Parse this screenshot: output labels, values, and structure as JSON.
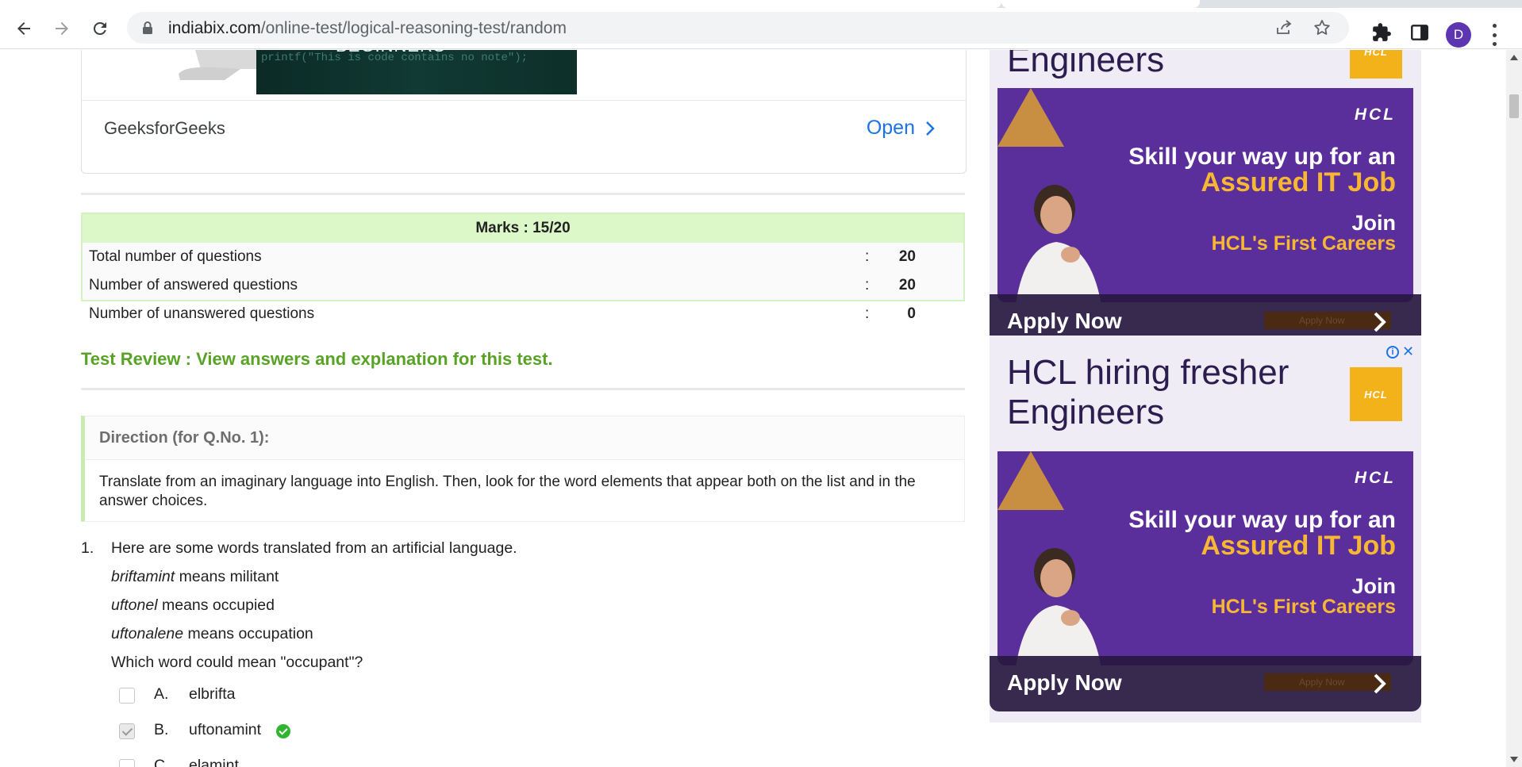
{
  "browser": {
    "url_host": "indiabix.com",
    "url_path": "/online-test/logical-reasoning-test/random",
    "profile_initial": "D"
  },
  "top_ad": {
    "thumbnail_heading": "BEGINNERS",
    "thumbnail_code": "printf(\"This is code contains no note\");",
    "brand": "GeeksforGeeks",
    "open_label": "Open"
  },
  "marks": {
    "heading": "Marks : 15/20",
    "rows": [
      {
        "label": "Total number of questions",
        "colon": ":",
        "value": "20"
      },
      {
        "label": "Number of answered questions",
        "colon": ":",
        "value": "20"
      },
      {
        "label": "Number of unanswered questions",
        "colon": ":",
        "value": "0"
      }
    ]
  },
  "review_link": "Test Review : View answers and explanation for this test.",
  "direction": {
    "heading": "Direction (for Q.No. 1):",
    "text": "Translate from an imaginary language into English. Then, look for the word elements that appear both on the list and in the answer choices."
  },
  "question": {
    "number": "1.",
    "intro": "Here are some words translated from an artificial language.",
    "definitions": [
      {
        "word": "briftamint",
        "meaning": " means militant"
      },
      {
        "word": "uftonel",
        "meaning": " means occupied"
      },
      {
        "word": "uftonalene",
        "meaning": " means occupation"
      }
    ],
    "prompt": "Which word could mean \"occupant\"?",
    "options": [
      {
        "letter": "A.",
        "text": "elbrifta",
        "checked": false,
        "correct": false
      },
      {
        "letter": "B.",
        "text": "uftonamint",
        "checked": true,
        "correct": true
      },
      {
        "letter": "C.",
        "text": "elamint",
        "checked": false,
        "correct": false
      }
    ]
  },
  "right_ads": [
    {
      "title_line1": "",
      "title_line2": "Engineers",
      "logo_text": "HCL",
      "banner_brand": "HCL",
      "banner_line1": "Skill your way up for an",
      "banner_line2": "Assured IT Job",
      "banner_line3": "Join",
      "banner_line4": "HCL's First Careers",
      "apply_label": "Apply Now",
      "ghost_label": "Apply Now"
    },
    {
      "title_line1": "HCL hiring fresher",
      "title_line2": "Engineers",
      "logo_text": "HCL",
      "banner_brand": "HCL",
      "banner_line1": "Skill your way up for an",
      "banner_line2": "Assured IT Job",
      "banner_line3": "Join",
      "banner_line4": "HCL's First Careers",
      "apply_label": "Apply Now",
      "ghost_label": "Apply Now",
      "adchoices_close": "✕",
      "adchoices_info": "i"
    }
  ],
  "colors": {
    "accent_green": "#58a325",
    "marks_header_bg": "#dcf7c8",
    "ad_purple": "#5b2f9b",
    "ad_yellow": "#f7b733",
    "link_blue": "#1a73e8"
  }
}
